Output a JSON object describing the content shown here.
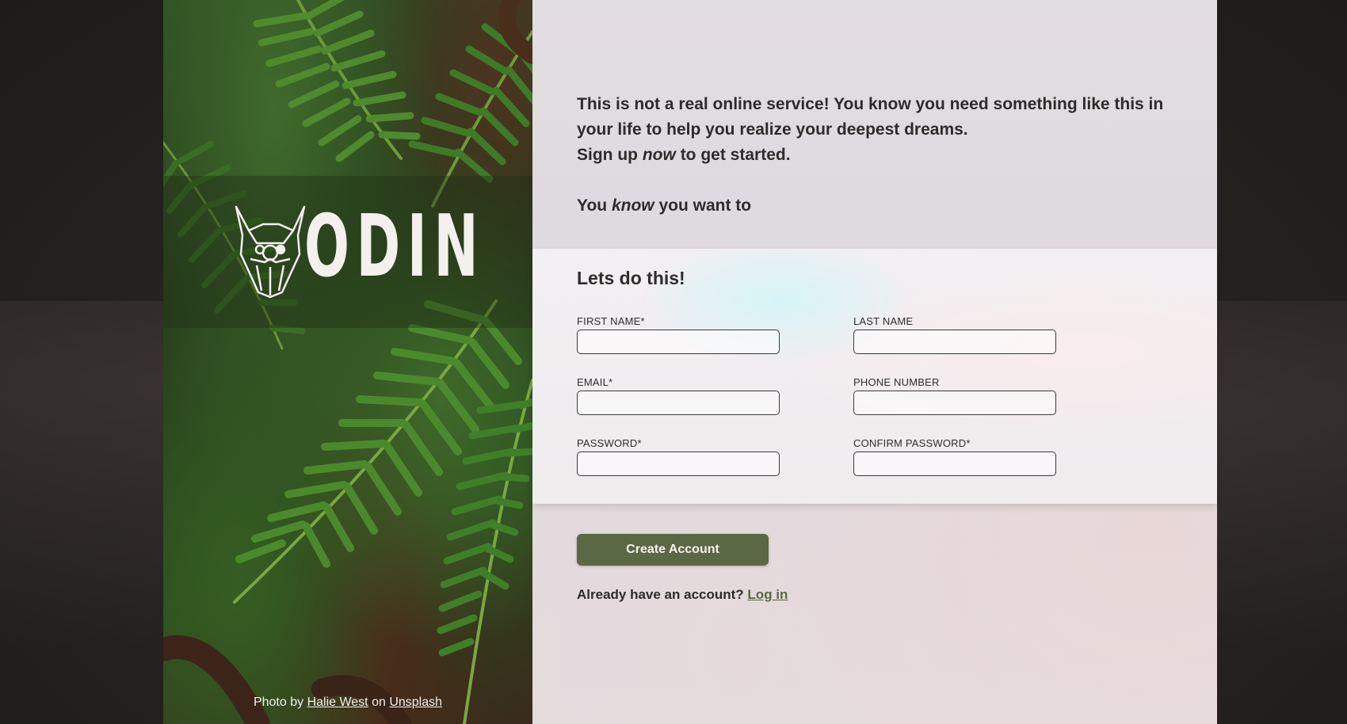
{
  "colors": {
    "accent": "#5a6845",
    "text": "#2f2b2b",
    "panel_bg": "#e2dde0",
    "card_bg": "#f2eff2",
    "backdrop": "#262222",
    "fern_green": "#3e6a2a"
  },
  "brand": {
    "logo_icon": "viking-helmet-icon",
    "logo_text": "ODIN"
  },
  "credit": {
    "prefix": "Photo by",
    "author": "Halie West",
    "middle": "on",
    "site": "Unsplash"
  },
  "intro": {
    "line1": "This is not a real online service! You know you need something like this in your life to help you realize your deepest dreams.",
    "line2_pre": "Sign up",
    "line2_em": "now",
    "line2_post": "to get started.",
    "know_pre": "You",
    "know_em": "know",
    "know_post": "you want to"
  },
  "form": {
    "title": "Lets do this!",
    "fields": {
      "first_name": {
        "label": "FIRST NAME*",
        "value": ""
      },
      "last_name": {
        "label": "LAST NAME",
        "value": ""
      },
      "email": {
        "label": "EMAIL*",
        "value": ""
      },
      "phone": {
        "label": "PHONE NUMBER",
        "value": ""
      },
      "password": {
        "label": "PASSWORD*",
        "value": ""
      },
      "confirm_password": {
        "label": "CONFIRM PASSWORD*",
        "value": ""
      }
    }
  },
  "actions": {
    "create_label": "Create Account",
    "login_prompt": "Already have an account?",
    "login_link": "Log in"
  }
}
